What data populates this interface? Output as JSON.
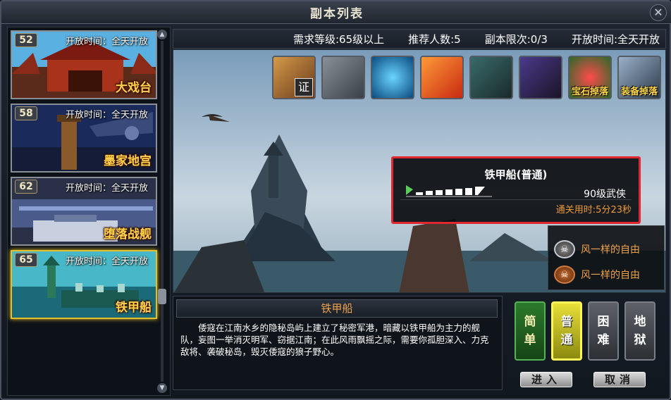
{
  "window": {
    "title": "副本列表",
    "close_label": "✕"
  },
  "dungeons": [
    {
      "level": "52",
      "open_time": "开放时间：全天开放",
      "name": "大戏台",
      "selected": false
    },
    {
      "level": "58",
      "open_time": "开放时间：全天开放",
      "name": "墨家地宫",
      "selected": false
    },
    {
      "level": "62",
      "open_time": "开放时间：全天开放",
      "name": "堕落战舰",
      "selected": false
    },
    {
      "level": "65",
      "open_time": "开放时间：全天开放",
      "name": "铁甲船",
      "selected": true
    }
  ],
  "info": {
    "req_level": "需求等级:65级以上",
    "recommend": "推荐人数:5",
    "limit": "副本限次:0/3",
    "open": "开放时间:全天开放"
  },
  "rewards": [
    {
      "icon": "crossbow-icon",
      "label": "",
      "badge": "证"
    },
    {
      "icon": "rune-stone-icon",
      "label": "",
      "badge": ""
    },
    {
      "icon": "crystal-icon",
      "label": "",
      "badge": ""
    },
    {
      "icon": "gift-box-icon",
      "label": "",
      "badge": ""
    },
    {
      "icon": "armor-icon",
      "label": "",
      "badge": ""
    },
    {
      "icon": "robe-icon",
      "label": "",
      "badge": ""
    },
    {
      "icon": "gem-drop-icon",
      "label": "宝石掉落",
      "badge": ""
    },
    {
      "icon": "equip-drop-icon",
      "label": "装备掉落",
      "badge": ""
    }
  ],
  "tooltip": {
    "name": "铁甲船(普通)",
    "class": "90级武侠",
    "clear_time": "通关用时:5分23秒"
  },
  "ranking": [
    {
      "name": "风一样的自由",
      "medal": "silver"
    },
    {
      "name": "风一样的自由",
      "medal": "bronze"
    }
  ],
  "description": {
    "title": "铁甲船",
    "text": "倭寇在江南水乡的隐秘岛屿上建立了秘密军港，暗藏以铁甲船为主力的舰队，妄图一举消灭明军、窃据江南；在此风雨飘摇之际，需要你孤胆深入、力克敌将、袭破秘岛，毁灭倭寇的狼子野心。"
  },
  "difficulty": {
    "easy": [
      "简",
      "单"
    ],
    "normal": [
      "普",
      "通"
    ],
    "hard": [
      "困",
      "难"
    ],
    "hell": [
      "地",
      "狱"
    ],
    "selected": "normal"
  },
  "buttons": {
    "enter": "进入",
    "cancel": "取消"
  },
  "colors": {
    "selected_border": "#e6c028",
    "tooltip_border": "#e0262e",
    "name_gold": "#ffd24a",
    "accent_orange": "#f0a24a"
  }
}
